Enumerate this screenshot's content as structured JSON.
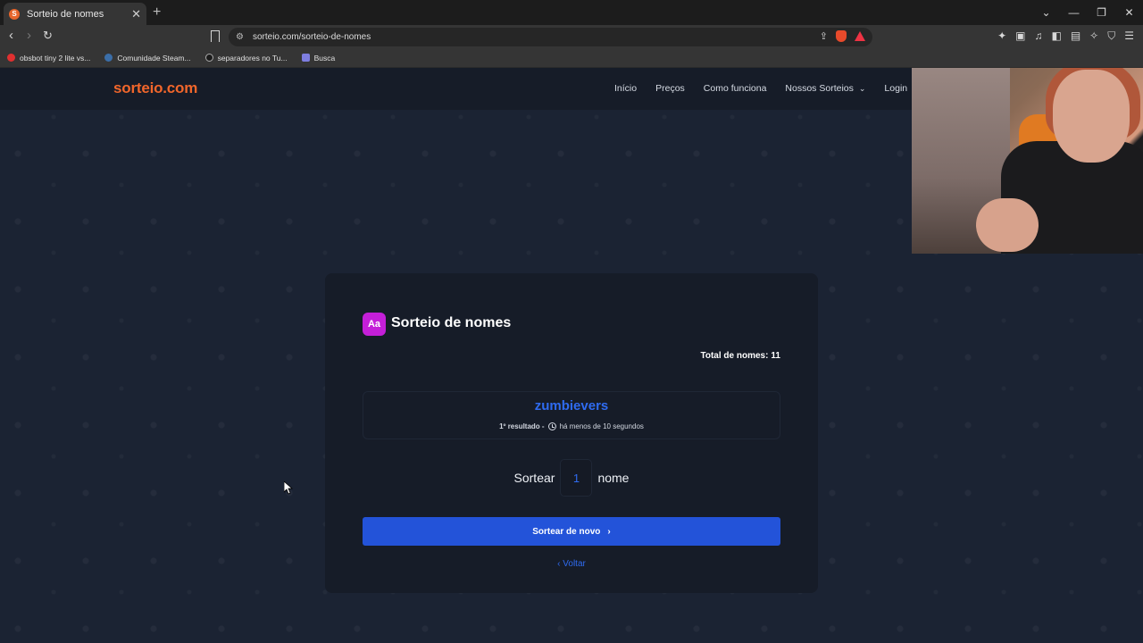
{
  "browser": {
    "tab_title": "Sorteio de nomes",
    "tab_favicon_letter": "S",
    "new_tab": "+",
    "url": "sorteio.com/sorteio-de-nomes",
    "bookmarks": [
      {
        "label": "obsbot tiny 2 lite vs...",
        "color": "#e03030"
      },
      {
        "label": "Comunidade Steam...",
        "color": "#3b6ea8"
      },
      {
        "label": "separadores no Tu...",
        "color": "#1b1b1b"
      },
      {
        "label": "Busca",
        "color": "#7e7ee0"
      }
    ]
  },
  "site": {
    "logo": "sorteio.com",
    "nav": [
      "Início",
      "Preços",
      "Como funciona",
      "Nossos Sorteios",
      "Login"
    ]
  },
  "card": {
    "icon_text": "Aa",
    "title": "Sorteio de nomes",
    "total_label": "Total de nomes:",
    "total_value": "11",
    "winner": "zumbievers",
    "result_label": "1º resultado -",
    "result_time": "há menos de 10 segundos",
    "draw_prefix": "Sortear",
    "draw_qty": "1",
    "draw_suffix": "nome",
    "button_label": "Sortear de novo",
    "back_label": "Voltar"
  },
  "colors": {
    "brand_orange": "#f1662b",
    "primary_blue": "#2353d9",
    "icon_magenta": "#c41fd8"
  }
}
